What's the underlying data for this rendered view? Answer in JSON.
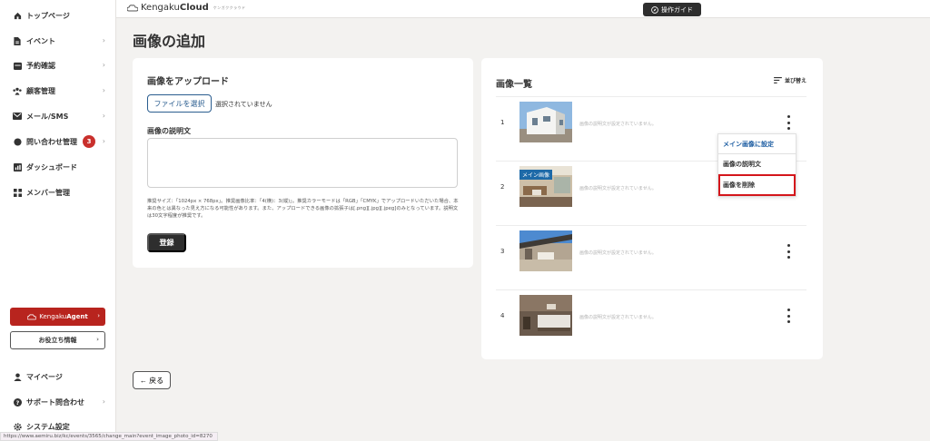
{
  "header": {
    "logo_brand": "Kengaku",
    "logo_brand_bold": "Cloud",
    "logo_sub": "ケンガククラウド",
    "guide_label": "操作ガイド"
  },
  "sidebar": {
    "items": [
      {
        "label": "トップページ",
        "icon": "home-icon"
      },
      {
        "label": "イベント",
        "icon": "document-icon"
      },
      {
        "label": "予約確認",
        "icon": "calendar-icon"
      },
      {
        "label": "顧客管理",
        "icon": "users-icon"
      },
      {
        "label": "メール/SMS",
        "icon": "mail-icon"
      },
      {
        "label": "問い合わせ管理",
        "icon": "chat-icon",
        "badge": "3"
      },
      {
        "label": "ダッシュボード",
        "icon": "chart-icon"
      },
      {
        "label": "メンバー管理",
        "icon": "grid-icon"
      }
    ],
    "agent_brand": "Kengaku",
    "agent_brand_bold": "Agent",
    "info_label": "お役立ち情報",
    "bottom_items": [
      {
        "label": "マイページ",
        "icon": "person-icon"
      },
      {
        "label": "サポート問合わせ",
        "icon": "help-icon"
      },
      {
        "label": "システム設定",
        "icon": "gear-icon"
      }
    ]
  },
  "page": {
    "title": "画像の追加",
    "back_label": "← 戻る"
  },
  "upload": {
    "heading": "画像をアップロード",
    "file_button": "ファイルを選択",
    "file_status": "選択されていません",
    "desc_label": "画像の説明文",
    "note": "推奨サイズ：「1024px × 768px」。推奨画像比率：「4(横)：3(縦)」。推奨カラーモードは「RGB」「CMYK」でアップロードいただいた場合、本来の色とは異なった見え方になる可能性があります。また、アップロードできる画像の拡張子は[.png][.jpg][.jpeg]のみとなっています。説明文は30文字程度が推奨です。",
    "submit_label": "登録"
  },
  "image_list": {
    "heading": "画像一覧",
    "sort_label": "並び替え",
    "main_tag": "メイン画像",
    "rows": [
      {
        "num": "1",
        "desc": "画像の説明文が設定されていません。"
      },
      {
        "num": "2",
        "desc": "画像の説明文が設定されていません。"
      },
      {
        "num": "3",
        "desc": "画像の説明文が設定されていません。"
      },
      {
        "num": "4",
        "desc": "画像の説明文が設定されていません。"
      }
    ]
  },
  "menu": {
    "set_main": "メイン画像に設定",
    "description": "画像の説明文",
    "delete": "画像を削除"
  },
  "statusbar": {
    "url": "https://www.aemiru.biz/kc/events/3565/change_main?event_image_photo_id=8270"
  },
  "colors": {
    "accent_blue": "#1f5fa3",
    "brand_red": "#b8241e",
    "badge_red": "#c9302c",
    "highlight_red": "#d4161b"
  }
}
